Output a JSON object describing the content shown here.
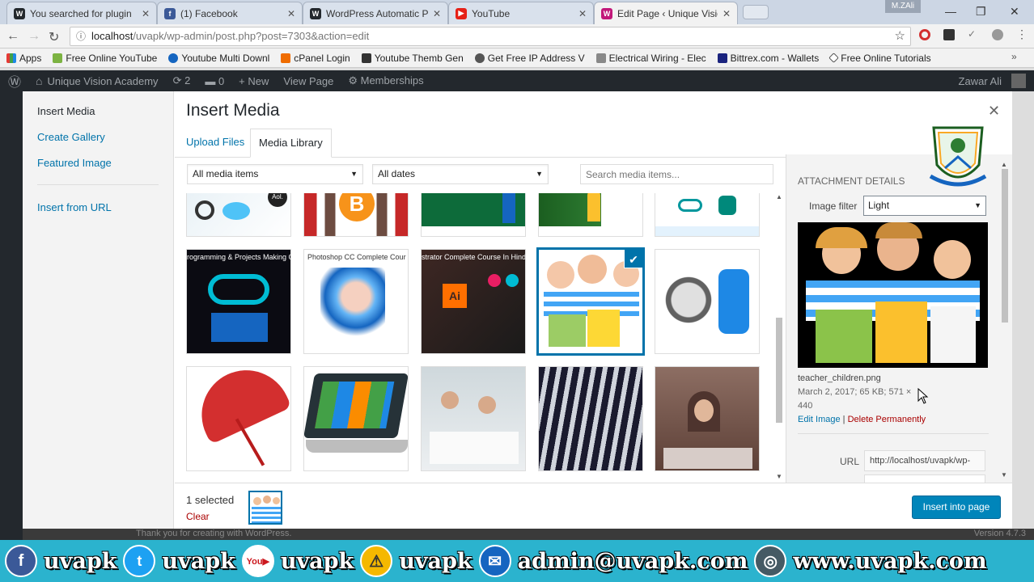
{
  "browser": {
    "tabs": [
      {
        "title": "You searched for plugin",
        "icon": "wordpress-icon",
        "color": "#23282d"
      },
      {
        "title": "(1) Facebook",
        "icon": "facebook-icon",
        "color": "#3b5998"
      },
      {
        "title": "WordPress Automatic Pl",
        "icon": "wordpress-icon",
        "color": "#23282d"
      },
      {
        "title": "YouTube",
        "icon": "youtube-icon",
        "color": "#e62117"
      },
      {
        "title": "Edit Page ‹ Unique Vision",
        "icon": "wordpress-icon",
        "color": "#c2187a"
      }
    ],
    "profile": "M.ZAli",
    "url_host": "localhost",
    "url_path": "/uvapk/wp-admin/post.php?post=7303&action=edit",
    "bookmarks": [
      "Apps",
      "Free Online YouTube",
      "Youtube Multi Downl",
      "cPanel Login",
      "Youtube Themb Gen",
      "Get Free IP Address V",
      "Electrical Wiring - Elec",
      "Bittrex.com - Wallets",
      "Free Online Tutorials"
    ]
  },
  "admin_bar": {
    "site": "Unique Vision Academy",
    "updates": "2",
    "comments": "0",
    "new": "New",
    "view": "View Page",
    "memberships": "Memberships",
    "user": "Zawar Ali"
  },
  "footer": {
    "text": "Thank you for creating with WordPress.",
    "version": "Version 4.7.3"
  },
  "modal": {
    "menu": [
      "Insert Media",
      "Create Gallery",
      "Featured Image",
      "Insert from URL"
    ],
    "title": "Insert Media",
    "tabs": [
      "Upload Files",
      "Media Library"
    ],
    "filter_type": "All media items",
    "filter_date": "All dates",
    "search_placeholder": "Search media items...",
    "selected_count": "1 selected",
    "clear": "Clear",
    "insert_button": "Insert into page",
    "thumb_texts": {
      "arduino": "rogramming & Projects Making Comp",
      "photoshop": "Photoshop CC Complete Course",
      "illustrator": "strator Complete Course In Hindi Urdu",
      "ai": "Ai"
    }
  },
  "details": {
    "heading": "ATTACHMENT DETAILS",
    "image_filter_label": "Image filter",
    "image_filter_value": "Light",
    "filename": "teacher_children.png",
    "meta": "March 2, 2017; 65 KB; 571 ×",
    "meta2": "440",
    "edit_link": "Edit Image",
    "sep": "|",
    "delete_link": "Delete Permanently",
    "url_label": "URL",
    "url_value": "http://localhost/uvapk/wp-"
  },
  "social": {
    "items": [
      {
        "icon": "facebook-icon",
        "text": "uvapk",
        "color": "#3b5998"
      },
      {
        "icon": "twitter-icon",
        "text": "uvapk",
        "color": "#1da1f2"
      },
      {
        "icon": "youtube-icon",
        "text": "uvapk",
        "color": "#cc181e"
      },
      {
        "icon": "warning-icon",
        "text": "uvapk",
        "color": "#f5b800"
      },
      {
        "icon": "email-icon",
        "text": "admin@uvapk.com",
        "color": "#1565c0"
      },
      {
        "icon": "globe-icon",
        "text": "www.uvapk.com",
        "color": "#455a64"
      }
    ]
  }
}
